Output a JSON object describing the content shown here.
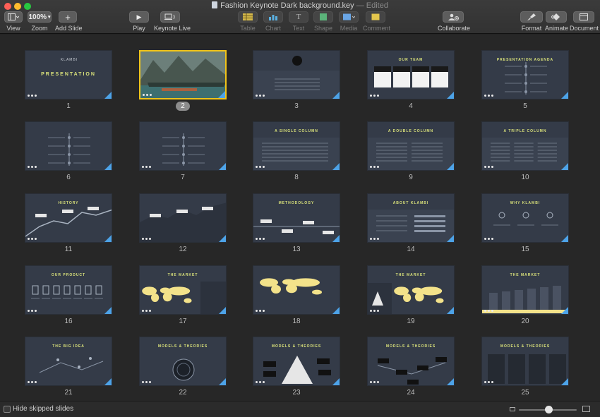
{
  "window": {
    "title": "Fashion Keynote Dark background.key",
    "edited": "— Edited"
  },
  "toolbar": {
    "view_label": "View",
    "zoom_value": "100%",
    "zoom_label": "Zoom",
    "add_slide_label": "Add Slide",
    "play_label": "Play",
    "keynote_live_label": "Keynote Live",
    "table_label": "Table",
    "chart_label": "Chart",
    "text_label": "Text",
    "shape_label": "Shape",
    "media_label": "Media",
    "comment_label": "Comment",
    "collaborate_label": "Collaborate",
    "format_label": "Format",
    "animate_label": "Animate",
    "document_label": "Document"
  },
  "slides": [
    {
      "number": "1",
      "title": "PRESENTATION"
    },
    {
      "number": "2",
      "title": ""
    },
    {
      "number": "3",
      "title": ""
    },
    {
      "number": "4",
      "title": "OUR TEAM"
    },
    {
      "number": "5",
      "title": "PRESENTATION AGENDA"
    },
    {
      "number": "6",
      "title": ""
    },
    {
      "number": "7",
      "title": ""
    },
    {
      "number": "8",
      "title": "A SINGLE COLUMN"
    },
    {
      "number": "9",
      "title": "A DOUBLE COLUMN"
    },
    {
      "number": "10",
      "title": "A TRIPLE COLUMN"
    },
    {
      "number": "11",
      "title": "HISTORY"
    },
    {
      "number": "12",
      "title": ""
    },
    {
      "number": "13",
      "title": "METHODOLOGY"
    },
    {
      "number": "14",
      "title": "ABOUT KLAMBI"
    },
    {
      "number": "15",
      "title": "WHY KLAMBI"
    },
    {
      "number": "16",
      "title": "OUR PRODUCT"
    },
    {
      "number": "17",
      "title": "THE MARKET"
    },
    {
      "number": "18",
      "title": ""
    },
    {
      "number": "19",
      "title": "THE MARKET"
    },
    {
      "number": "20",
      "title": "THE MARKET"
    },
    {
      "number": "21",
      "title": "THE BIG IDEA"
    },
    {
      "number": "22",
      "title": "MODELS & THEORIES"
    },
    {
      "number": "23",
      "title": "MODELS & THEORIES"
    },
    {
      "number": "24",
      "title": "MODELS & THEORIES"
    },
    {
      "number": "25",
      "title": "MODELS & THEORIES"
    }
  ],
  "selected_slide": "2",
  "bottombar": {
    "hide_skipped_label": "Hide skipped slides"
  },
  "colors": {
    "accent": "#f0c419",
    "slide_bg": "#343b48",
    "title_text": "#d8e07a",
    "corner_badge": "#4da3e8"
  }
}
